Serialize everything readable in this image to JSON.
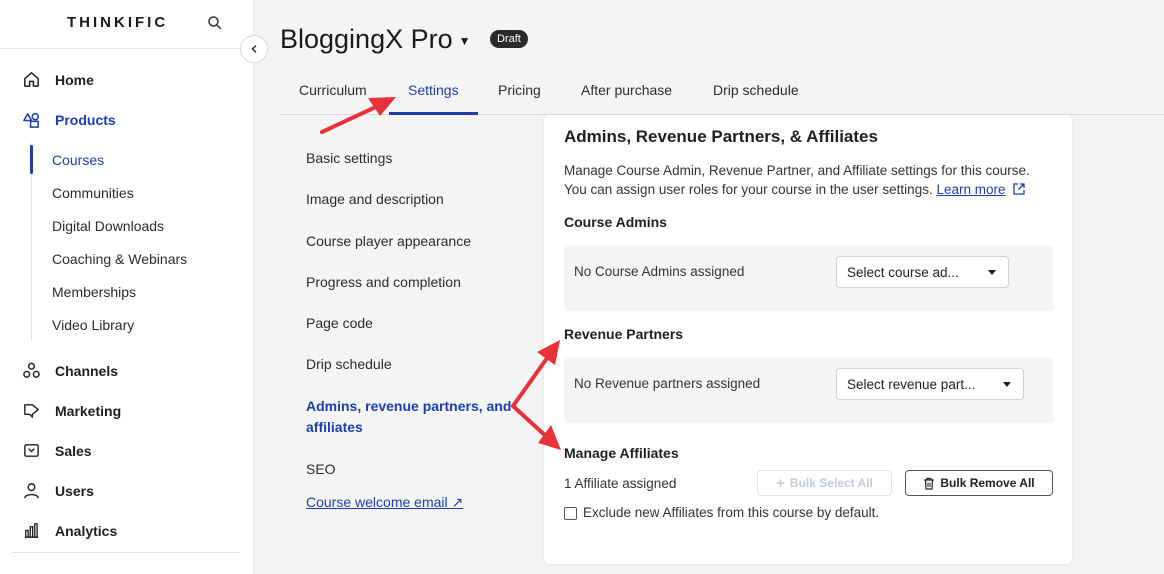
{
  "brand": "THINKIFIC",
  "sidebar": {
    "home": "Home",
    "products": "Products",
    "sub_items": [
      "Courses",
      "Communities",
      "Digital Downloads",
      "Coaching & Webinars",
      "Memberships",
      "Video Library"
    ],
    "channels": "Channels",
    "marketing": "Marketing",
    "sales": "Sales",
    "users": "Users",
    "analytics": "Analytics"
  },
  "header": {
    "title": "BloggingX Pro",
    "badge": "Draft"
  },
  "tabs": [
    "Curriculum",
    "Settings",
    "Pricing",
    "After purchase",
    "Drip schedule"
  ],
  "settings_nav": {
    "items": [
      "Basic settings",
      "Image and description",
      "Course player appearance",
      "Progress and completion",
      "Page code",
      "Drip schedule"
    ],
    "active": "Admins, revenue partners, and affiliates",
    "seo": "SEO",
    "welcome_email": "Course welcome email ↗"
  },
  "card": {
    "title": "Admins, Revenue Partners, & Affiliates",
    "desc": "Manage Course Admin, Revenue Partner, and Affiliate settings for this course. You can assign user roles for your course in the user settings.",
    "learn_more": "Learn more",
    "admins": {
      "title": "Course Admins",
      "empty": "No Course Admins assigned",
      "select": "Select course ad..."
    },
    "partners": {
      "title": "Revenue Partners",
      "empty": "No Revenue partners assigned",
      "select": "Select revenue part..."
    },
    "affiliates": {
      "title": "Manage Affiliates",
      "count": "1 Affiliate assigned",
      "bulk_select": "Bulk Select All",
      "bulk_remove": "Bulk Remove All",
      "exclude": "Exclude new Affiliates from this course by default."
    }
  },
  "colors": {
    "accent": "#1d3ea8",
    "annotation_arrow": "#e8323a"
  }
}
